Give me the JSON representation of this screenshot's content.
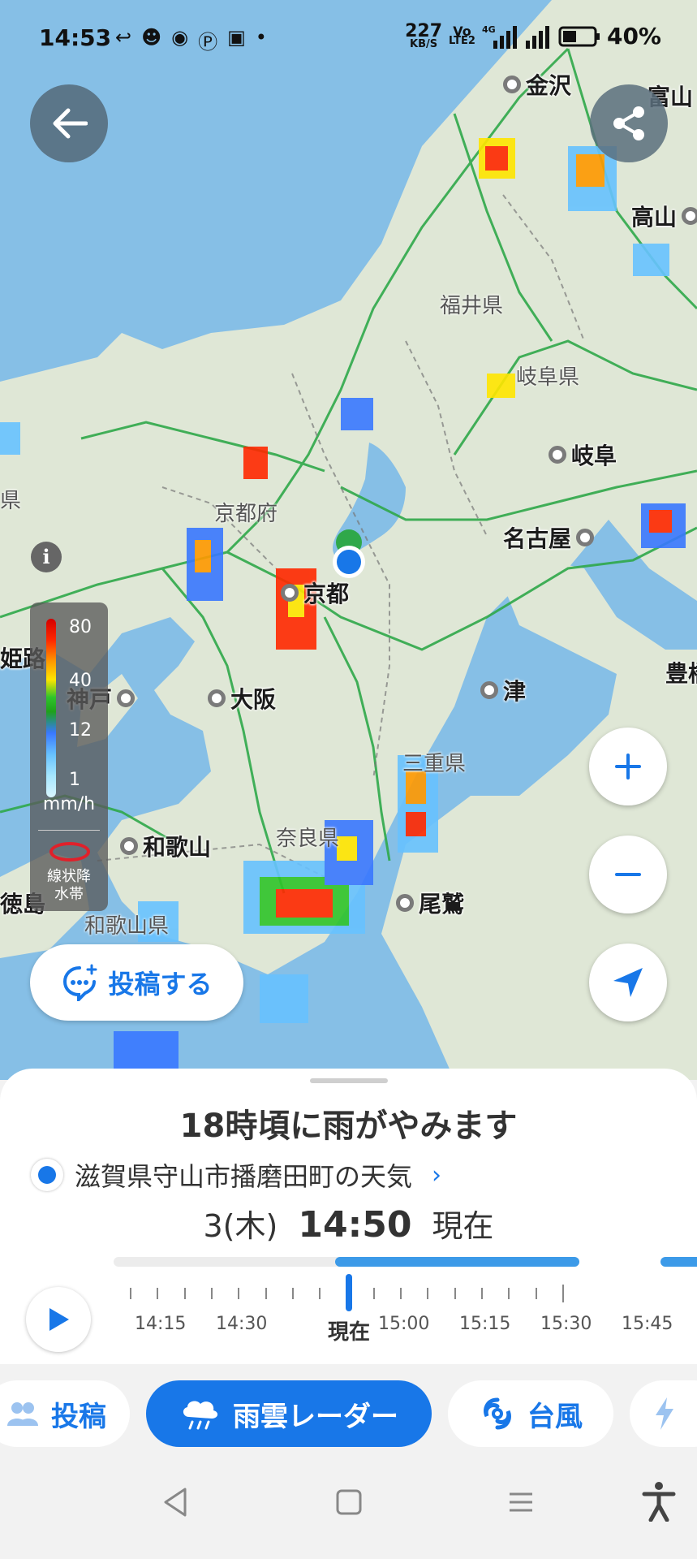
{
  "status_bar": {
    "time": "14:53",
    "speed_value": "227",
    "speed_unit": "KB/S",
    "volte": "Vo",
    "lte": "LTE2",
    "network": "4G",
    "battery_percent": "40%"
  },
  "map": {
    "cities": [
      {
        "name": "金沢"
      },
      {
        "name": "富山"
      },
      {
        "name": "高山"
      },
      {
        "name": "岐阜"
      },
      {
        "name": "名古屋"
      },
      {
        "name": "京都"
      },
      {
        "name": "姫路"
      },
      {
        "name": "神戸"
      },
      {
        "name": "大阪"
      },
      {
        "name": "津"
      },
      {
        "name": "豊橋"
      },
      {
        "name": "和歌山"
      },
      {
        "name": "尾鷲"
      },
      {
        "name": "徳島"
      }
    ],
    "prefectures": [
      {
        "name": "福井県"
      },
      {
        "name": "岐阜県"
      },
      {
        "name": "京都府"
      },
      {
        "name": "三重県"
      },
      {
        "name": "奈良県"
      },
      {
        "name": "和歌山県"
      },
      {
        "name": "県"
      }
    ]
  },
  "legend": {
    "levels": [
      "80",
      "40",
      "12",
      "1"
    ],
    "unit": "mm/h",
    "linear_band": "線状降水帯"
  },
  "post_button_label": "投稿する",
  "sheet": {
    "headline": "18時頃に雨がやみます",
    "location": "滋賀県守山市播磨田町の天気",
    "date": "3(木)",
    "time": "14:50",
    "now": "現在"
  },
  "timeline": {
    "labels": [
      "14:15",
      "14:30",
      "15:00",
      "15:15",
      "15:30",
      "15:45"
    ],
    "now_label": "現在"
  },
  "modes": [
    {
      "label": "投稿"
    },
    {
      "label": "雨雲レーダー"
    },
    {
      "label": "台風"
    }
  ],
  "colors": {
    "accent": "#1877e8",
    "sea": "#86bfe6",
    "land": "#dfe7d6",
    "roads": "#2fa84a"
  }
}
